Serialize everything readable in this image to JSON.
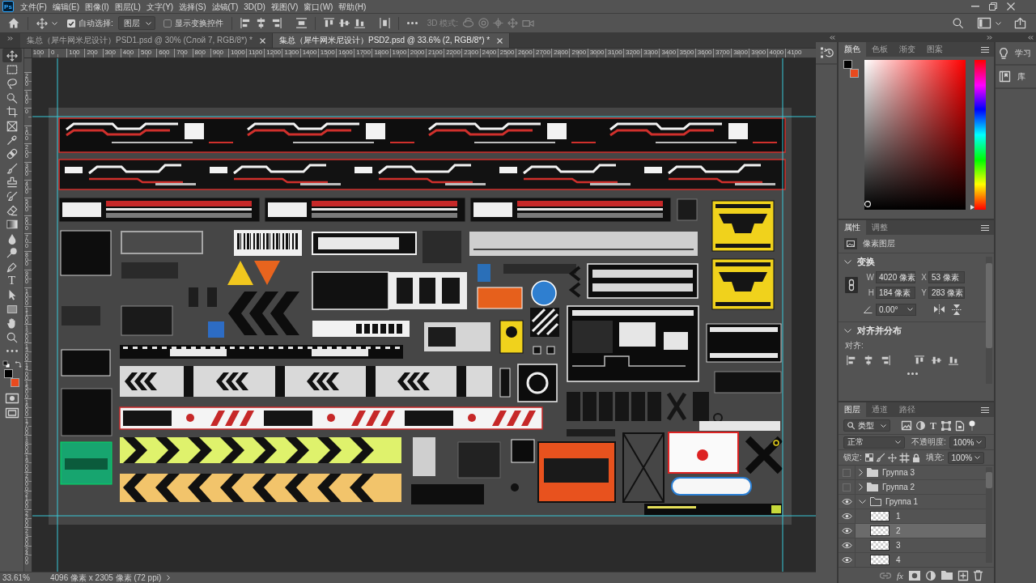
{
  "app": {
    "logo": "Ps"
  },
  "menu": [
    "文件(F)",
    "编辑(E)",
    "图像(I)",
    "图层(L)",
    "文字(Y)",
    "选择(S)",
    "滤镜(T)",
    "3D(D)",
    "视图(V)",
    "窗口(W)",
    "帮助(H)"
  ],
  "options_bar": {
    "auto_select": {
      "label": "自动选择:",
      "checked": true
    },
    "target": "图层",
    "show_transform": {
      "label": "显示变换控件",
      "checked": false
    },
    "mode_3d": {
      "label": "3D 模式:",
      "disabled": true
    }
  },
  "document_tabs": [
    {
      "title": "集总（犀牛网米尼设计）PSD1.psd @ 30% (Слой 7, RGB/8*) *",
      "selected": false
    },
    {
      "title": "集总（犀牛网米尼设计）PSD2.psd @ 33.6% (2, RGB/8*) *",
      "selected": true
    }
  ],
  "toolbar": {
    "tools": [
      {
        "kind": "move",
        "selected": true
      },
      {
        "kind": "marquee",
        "selected": false
      },
      {
        "kind": "lasso",
        "selected": false
      },
      {
        "kind": "quick-select",
        "selected": false
      },
      {
        "kind": "crop",
        "selected": false
      },
      {
        "kind": "frame",
        "selected": false
      },
      {
        "kind": "eyedropper",
        "selected": false
      },
      {
        "kind": "healing",
        "selected": false
      },
      {
        "kind": "brush",
        "selected": false
      },
      {
        "kind": "stamp",
        "selected": false
      },
      {
        "kind": "history-brush",
        "selected": false
      },
      {
        "kind": "eraser",
        "selected": false
      },
      {
        "kind": "gradient",
        "selected": false
      },
      {
        "kind": "blur",
        "selected": false
      },
      {
        "kind": "dodge",
        "selected": false
      },
      {
        "kind": "pen",
        "selected": false
      },
      {
        "kind": "type",
        "glyph": "T",
        "selected": false
      },
      {
        "kind": "path-select",
        "selected": false
      },
      {
        "kind": "shape",
        "selected": false
      },
      {
        "kind": "hand",
        "selected": false
      },
      {
        "kind": "zoom",
        "selected": false
      },
      {
        "kind": "more",
        "selected": false
      }
    ],
    "swatches": [
      {
        "kind": "foreground",
        "color": "#000000"
      },
      {
        "kind": "background",
        "color": "#e84a1e"
      }
    ]
  },
  "rulers": {
    "horizontal": [
      "100",
      "0",
      "100",
      "200",
      "300",
      "400",
      "500",
      "600",
      "700",
      "800",
      "900",
      "1000",
      "1100",
      "1200",
      "1300",
      "1400",
      "1500",
      "1600",
      "1700",
      "1800",
      "1900",
      "2000",
      "2100",
      "2200",
      "2300",
      "2400",
      "2500",
      "2600",
      "2700",
      "2800",
      "2900",
      "3000",
      "3100",
      "3200",
      "3300",
      "3400",
      "3500",
      "3600",
      "3700",
      "3800",
      "3900",
      "4000",
      "4100"
    ],
    "vertical": [
      "200",
      "100",
      "0",
      "100",
      "200",
      "300",
      "400",
      "500",
      "600",
      "700",
      "800",
      "900",
      "1000",
      "1100",
      "1200",
      "1300",
      "1400",
      "1500",
      "1600",
      "1700",
      "1800",
      "1900",
      "2000",
      "2100",
      "2200",
      "2300",
      "2400"
    ]
  },
  "color_panel": {
    "tabs": [
      {
        "label": "颜色",
        "selected": true
      },
      {
        "label": "色板",
        "selected": false
      },
      {
        "label": "渐变",
        "selected": false
      },
      {
        "label": "图案",
        "selected": false
      }
    ],
    "swatches": [
      {
        "kind": "foreground",
        "color": "#000000"
      },
      {
        "kind": "background",
        "color": "#e84a1e"
      }
    ],
    "hue": {
      "level": 0
    }
  },
  "dock": [
    {
      "kind": "learn",
      "label": "学习"
    },
    {
      "kind": "libraries",
      "label": "库"
    }
  ],
  "properties_panel": {
    "tabs": [
      {
        "label": "属性",
        "selected": true
      },
      {
        "label": "调整",
        "selected": false
      }
    ],
    "layer_kind": "像素图层",
    "transform": {
      "title": "变换",
      "expanded": true,
      "fields": [
        {
          "label": "W",
          "value": "4020 像素"
        },
        {
          "label": "X",
          "value": "53 像素"
        },
        {
          "label": "H",
          "value": "184 像素"
        },
        {
          "label": "Y",
          "value": "283 像素"
        }
      ],
      "angle": "0.00°"
    },
    "align": {
      "title": "对齐并分布",
      "expanded": true,
      "label": "对齐:"
    }
  },
  "layers_panel": {
    "tabs": [
      {
        "label": "图层",
        "selected": true
      },
      {
        "label": "通道",
        "selected": false
      },
      {
        "label": "路径",
        "selected": false
      }
    ],
    "filter": "类型",
    "filter_glyph": "T",
    "blend_mode": "正常",
    "opacity": {
      "label": "不透明度:",
      "value": "100%"
    },
    "lock_label": "锁定:",
    "fill": {
      "label": "填充:",
      "value": "100%"
    },
    "layers": [
      {
        "name": "Группа 3",
        "kind": "group",
        "visible": false,
        "expanded": false,
        "selected": false
      },
      {
        "name": "Группа 2",
        "kind": "group",
        "visible": false,
        "expanded": false,
        "selected": false
      },
      {
        "name": "Группа 1",
        "kind": "group",
        "visible": true,
        "expanded": true,
        "selected": false,
        "children": [
          {
            "name": "1",
            "kind": "pixel",
            "visible": true,
            "selected": false
          },
          {
            "name": "2",
            "kind": "pixel",
            "visible": true,
            "selected": true
          },
          {
            "name": "3",
            "kind": "pixel",
            "visible": true,
            "selected": false
          },
          {
            "name": "4",
            "kind": "pixel",
            "visible": true,
            "selected": false
          }
        ]
      }
    ],
    "effects_glyph": "fx"
  },
  "status_bar": {
    "zoom": "33.61%",
    "info": "4096 像素 x 2305 像素 (72 ppi)"
  }
}
